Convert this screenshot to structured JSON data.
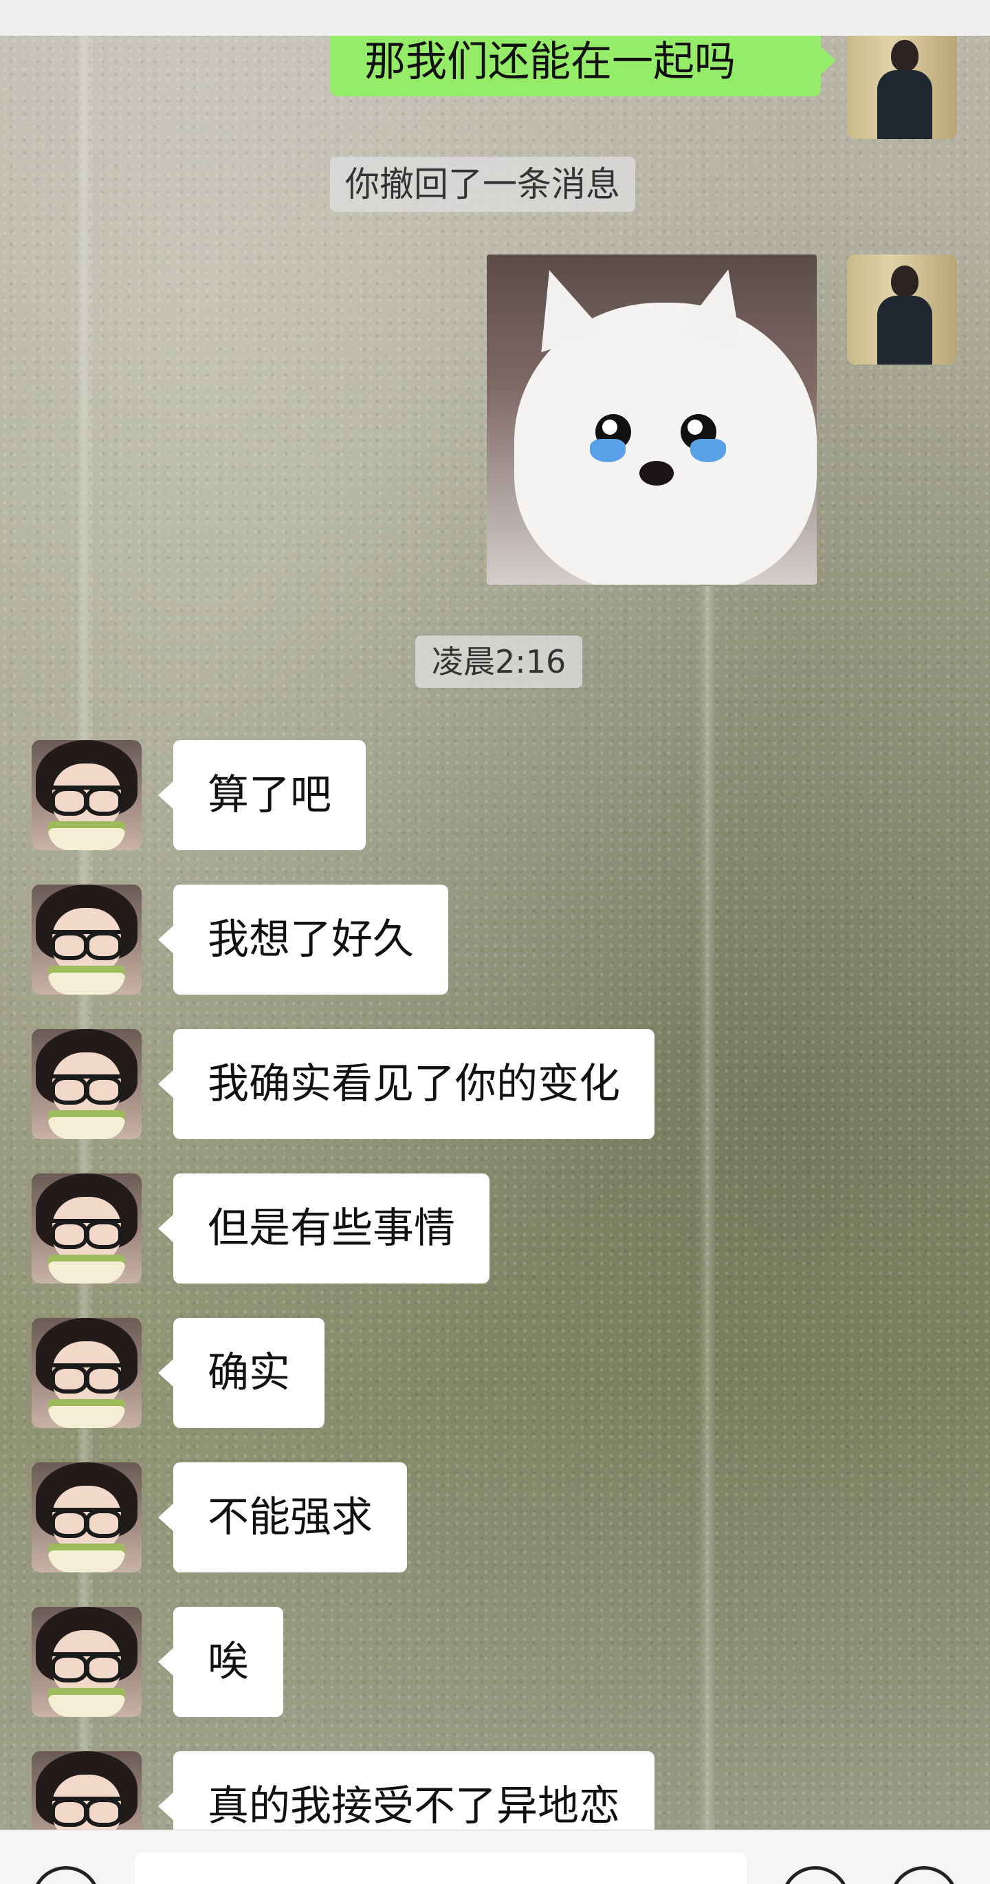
{
  "messages": {
    "m1": "那我们还能在一起吗",
    "recalled": "你撤回了一条消息",
    "sticker_name": "crying-dog-sticker",
    "time": "凌晨2:16",
    "r1": "算了吧",
    "r2": "我想了好久",
    "r3": "我确实看见了你的变化",
    "r4": "但是有些事情",
    "r5": "确实",
    "r6": "不能强求",
    "r7": "唉",
    "r8": "真的我接受不了异地恋"
  },
  "colors": {
    "sent_bubble": "#95ec69",
    "received_bubble": "#ffffff"
  },
  "icons": {
    "voice": "voice-icon",
    "emoji": "emoji-icon",
    "plus": "plus-icon"
  }
}
